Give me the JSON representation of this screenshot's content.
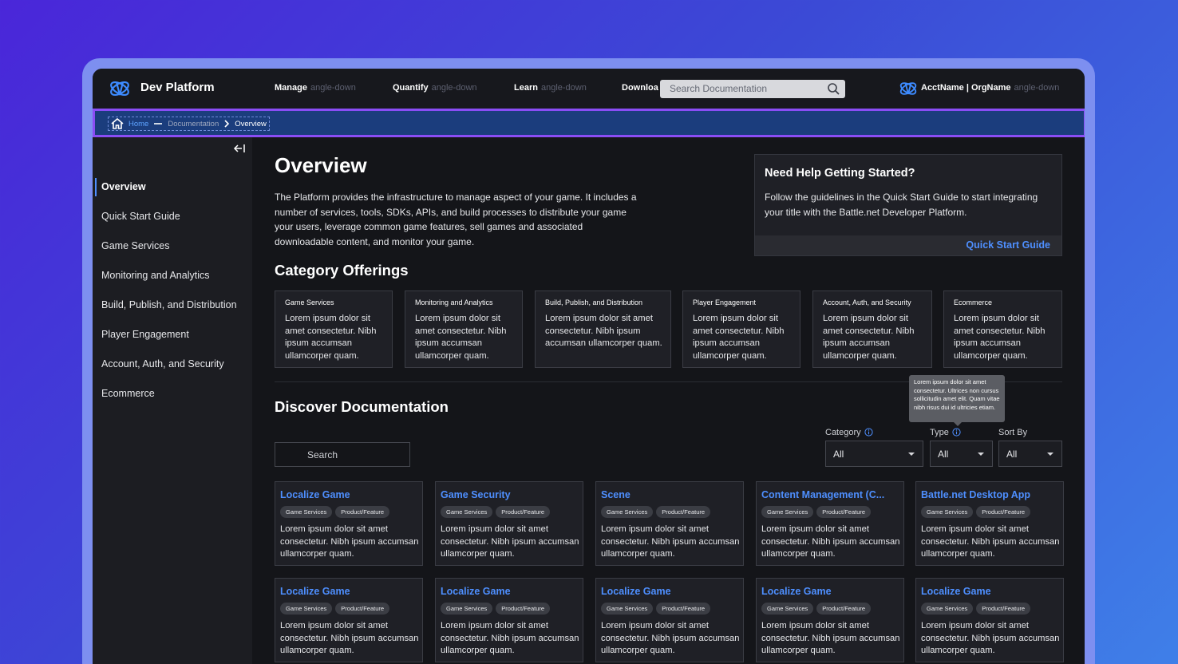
{
  "header": {
    "brand": "Dev Platform",
    "nav": [
      {
        "label": "Manage",
        "suffix": "angle-down"
      },
      {
        "label": "Quantify",
        "suffix": "angle-down"
      },
      {
        "label": "Learn",
        "suffix": "angle-down"
      },
      {
        "label": "Downloa",
        "suffix": ""
      }
    ],
    "search_placeholder": "Search Documentation",
    "account": {
      "label": "AcctName | OrgName",
      "suffix": "angle-down"
    }
  },
  "breadcrumb": {
    "home": "Home",
    "middle": "Documentation",
    "current": "Overview"
  },
  "sidebar": {
    "items": [
      {
        "label": "Overview",
        "active": true
      },
      {
        "label": "Quick Start Guide"
      },
      {
        "label": "Game Services"
      },
      {
        "label": "Monitoring and Analytics"
      },
      {
        "label": "Build, Publish, and Distribution"
      },
      {
        "label": "Player Engagement"
      },
      {
        "label": "Account, Auth, and Security"
      },
      {
        "label": "Ecommerce"
      }
    ]
  },
  "main": {
    "title": "Overview",
    "intro": "The Platform provides the infrastructure to manage aspect of your game. It includes a number of services, tools, SDKs, APIs, and build processes to distribute your game your users, leverage common game features, sell games and associated downloadable content, and monitor your game.",
    "help": {
      "title": "Need Help Getting Started?",
      "body": "Follow the guidelines in the Quick Start Guide to start integrating your title with the Battle.net Developer Platform.",
      "link": "Quick Start Guide"
    },
    "category_heading": "Category Offerings",
    "categories": [
      {
        "title": "Game Services",
        "desc": "Lorem ipsum dolor sit amet consectetur. Nibh ipsum accumsan ullamcorper quam."
      },
      {
        "title": "Monitoring and Analytics",
        "desc": "Lorem ipsum dolor sit amet consectetur. Nibh ipsum accumsan ullamcorper quam."
      },
      {
        "title": "Build, Publish, and Distribution",
        "desc": "Lorem ipsum dolor sit amet consectetur. Nibh ipsum accumsan ullamcorper quam."
      },
      {
        "title": "Player Engagement",
        "desc": "Lorem ipsum dolor sit amet consectetur. Nibh ipsum accumsan ullamcorper quam."
      },
      {
        "title": "Account, Auth, and Security",
        "desc": "Lorem ipsum dolor sit amet consectetur. Nibh ipsum accumsan ullamcorper quam."
      },
      {
        "title": "Ecommerce",
        "desc": "Lorem ipsum dolor sit amet consectetur. Nibh ipsum accumsan ullamcorper quam."
      }
    ],
    "discover_heading": "Discover Documentation",
    "tooltip": "Lorem ipsum dolor sit amet consectetur. Ultrices non cursus sollicitudin amet elit. Quam vitae nibh risus dui id ultricies etiam.",
    "search_placeholder": "Search",
    "filters": [
      {
        "label": "Category",
        "value": "All"
      },
      {
        "label": "Type",
        "value": "All"
      },
      {
        "label": "Sort By",
        "value": "All"
      }
    ],
    "docs": [
      {
        "title": "Localize Game",
        "tags": [
          "Game Services",
          "Product/Feature"
        ],
        "desc": "Lorem ipsum dolor sit amet consectetur. Nibh ipsum accumsan ullamcorper quam."
      },
      {
        "title": "Game Security",
        "tags": [
          "Game Services",
          "Product/Feature"
        ],
        "desc": "Lorem ipsum dolor sit amet consectetur. Nibh ipsum accumsan ullamcorper quam."
      },
      {
        "title": "Scene",
        "tags": [
          "Game Services",
          "Product/Feature"
        ],
        "desc": "Lorem ipsum dolor sit amet consectetur. Nibh ipsum accumsan ullamcorper quam."
      },
      {
        "title": "Content Management (C...",
        "tags": [
          "Game Services",
          "Product/Feature"
        ],
        "desc": "Lorem ipsum dolor sit amet consectetur. Nibh ipsum accumsan ullamcorper quam."
      },
      {
        "title": "Battle.net Desktop App",
        "tags": [
          "Game Services",
          "Product/Feature"
        ],
        "desc": "Lorem ipsum dolor sit amet consectetur. Nibh ipsum accumsan ullamcorper quam."
      },
      {
        "title": "Localize Game",
        "tags": [
          "Game Services",
          "Product/Feature"
        ],
        "desc": "Lorem ipsum dolor sit amet consectetur. Nibh ipsum accumsan ullamcorper quam."
      },
      {
        "title": "Localize Game",
        "tags": [
          "Game Services",
          "Product/Feature"
        ],
        "desc": "Lorem ipsum dolor sit amet consectetur. Nibh ipsum accumsan ullamcorper quam."
      },
      {
        "title": "Localize Game",
        "tags": [
          "Game Services",
          "Product/Feature"
        ],
        "desc": "Lorem ipsum dolor sit amet consectetur. Nibh ipsum accumsan ullamcorper quam."
      },
      {
        "title": "Localize Game",
        "tags": [
          "Game Services",
          "Product/Feature"
        ],
        "desc": "Lorem ipsum dolor sit amet consectetur. Nibh ipsum accumsan ullamcorper quam."
      },
      {
        "title": "Localize Game",
        "tags": [
          "Game Services",
          "Product/Feature"
        ],
        "desc": "Lorem ipsum dolor sit amet consectetur. Nibh ipsum accumsan ullamcorper quam."
      }
    ]
  },
  "colors": {
    "accent": "#4e8fff",
    "breadcrumb_bg": "#1b3d7d",
    "highlight": "#8a4df5"
  },
  "icons": {
    "logo": "battlenet-logo-icon",
    "search": "search-icon",
    "collapse": "collapse-sidebar-icon",
    "home": "home-icon",
    "chevron": "chevron-right-icon",
    "info": "info-icon",
    "caret": "caret-down-icon"
  }
}
